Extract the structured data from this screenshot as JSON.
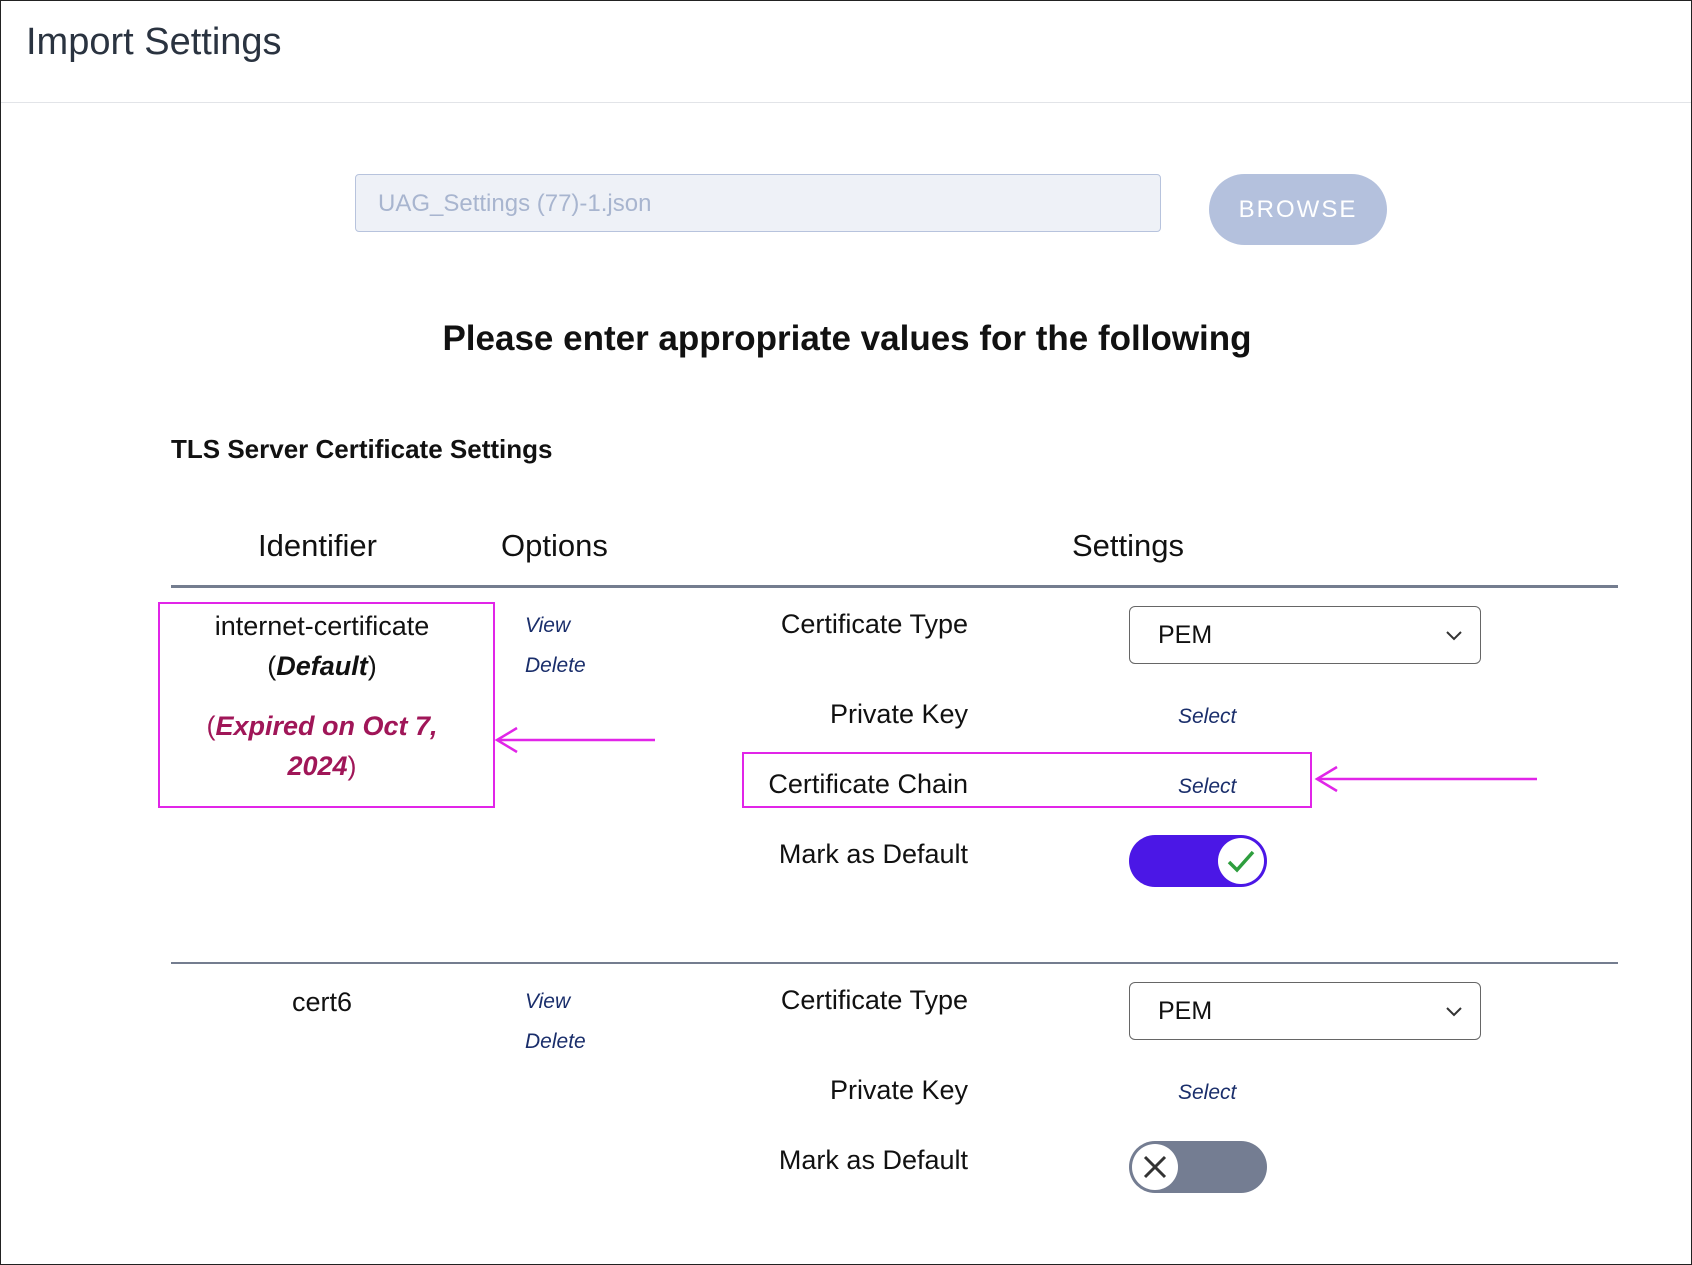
{
  "header": {
    "title": "Import Settings"
  },
  "file": {
    "value": "UAG_Settings (77)-1.json",
    "browse_label": "BROWSE"
  },
  "prompt": "Please enter appropriate values for the following",
  "section_title": "TLS Server Certificate Settings",
  "columns": {
    "identifier": "Identifier",
    "options": "Options",
    "settings": "Settings"
  },
  "certs": [
    {
      "identifier": "internet-certificate",
      "default_tag": "Default",
      "expired_line1": "Expired on Oct 7,",
      "expired_line2": "2024",
      "view_label": "View",
      "delete_label": "Delete",
      "certificate_type_label": "Certificate Type",
      "certificate_type_value": "PEM",
      "private_key_label": "Private Key",
      "private_key_action": "Select",
      "certificate_chain_label": "Certificate Chain",
      "certificate_chain_action": "Select",
      "mark_default_label": "Mark as Default",
      "mark_default": true
    },
    {
      "identifier": "cert6",
      "view_label": "View",
      "delete_label": "Delete",
      "certificate_type_label": "Certificate Type",
      "certificate_type_value": "PEM",
      "private_key_label": "Private Key",
      "private_key_action": "Select",
      "mark_default_label": "Mark as Default",
      "mark_default": false
    }
  ],
  "icons": {
    "dropdown": "chevron-down-icon",
    "toggle_on": "check-icon",
    "toggle_off": "close-icon",
    "annotation": "arrow-left-icon"
  },
  "colors": {
    "accent": "#4b17e6",
    "expired": "#a01658",
    "annotation": "#e125e8",
    "link": "#1a2e6b",
    "toggle_off": "#747d92",
    "check": "#2e9e3e"
  }
}
